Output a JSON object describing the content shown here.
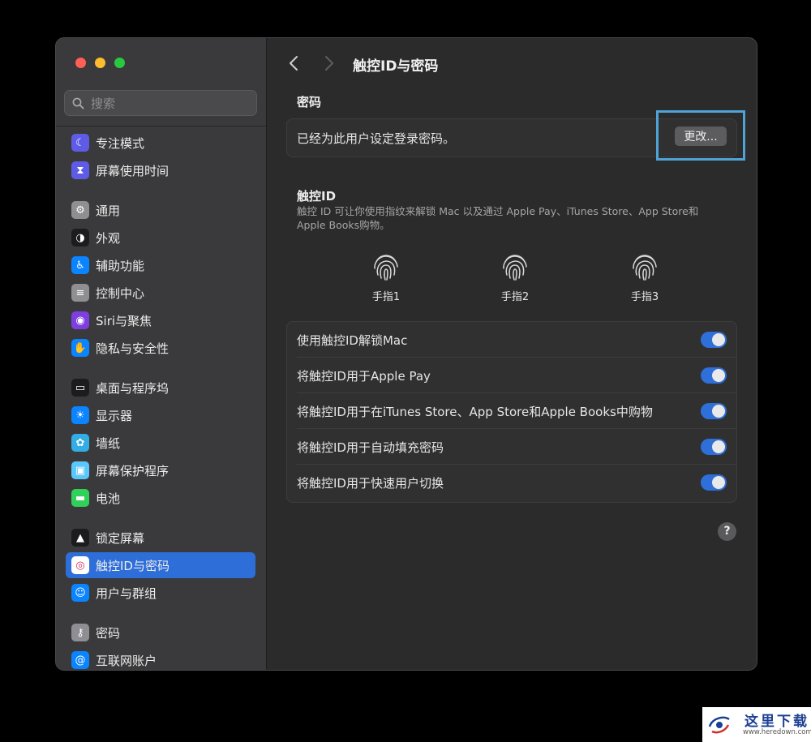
{
  "sidebar": {
    "search_placeholder": "搜索",
    "items": [
      {
        "label": "专注模式",
        "icon": "moon-icon",
        "color": "#5e5ce6"
      },
      {
        "label": "屏幕使用时间",
        "icon": "hourglass-icon",
        "color": "#5e5ce6"
      },
      {
        "label": "通用",
        "icon": "gear-icon",
        "color": "#8e8e93"
      },
      {
        "label": "外观",
        "icon": "appearance-icon",
        "color": "#1c1c1e"
      },
      {
        "label": "辅助功能",
        "icon": "accessibility-icon",
        "color": "#0a84ff"
      },
      {
        "label": "控制中心",
        "icon": "control-center-icon",
        "color": "#8e8e93"
      },
      {
        "label": "Siri与聚焦",
        "icon": "siri-icon",
        "color": "#7d3fe0"
      },
      {
        "label": "隐私与安全性",
        "icon": "hand-icon",
        "color": "#0a84ff"
      },
      {
        "label": "桌面与程序坞",
        "icon": "dock-icon",
        "color": "#1c1c1e"
      },
      {
        "label": "显示器",
        "icon": "sun-icon",
        "color": "#0a84ff"
      },
      {
        "label": "墙纸",
        "icon": "flower-icon",
        "color": "#32ade6"
      },
      {
        "label": "屏幕保护程序",
        "icon": "screensaver-icon",
        "color": "#5ac8fa"
      },
      {
        "label": "电池",
        "icon": "battery-icon",
        "color": "#30d158"
      },
      {
        "label": "锁定屏幕",
        "icon": "lock-icon",
        "color": "#1c1c1e"
      },
      {
        "label": "触控ID与密码",
        "icon": "fingerprint-icon",
        "color": "#ffffff"
      },
      {
        "label": "用户与群组",
        "icon": "users-icon",
        "color": "#0a84ff"
      },
      {
        "label": "密码",
        "icon": "key-icon",
        "color": "#8e8e93"
      },
      {
        "label": "互联网账户",
        "icon": "at-icon",
        "color": "#0a84ff"
      }
    ],
    "selected_label": "触控ID与密码"
  },
  "header": {
    "title": "触控ID与密码"
  },
  "password": {
    "section_title": "密码",
    "status_text": "已经为此用户设定登录密码。",
    "change_button": "更改..."
  },
  "touch_id": {
    "section_title": "触控ID",
    "description": "触控 ID 可让你使用指纹来解锁 Mac 以及通过 Apple Pay、iTunes Store、App Store和 Apple Books购物。",
    "fingers": [
      "手指1",
      "手指2",
      "手指3"
    ],
    "options": [
      {
        "label": "使用触控ID解锁Mac",
        "on": true
      },
      {
        "label": "将触控ID用于Apple Pay",
        "on": true
      },
      {
        "label": "将触控ID用于在iTunes Store、App Store和Apple Books中购物",
        "on": true
      },
      {
        "label": "将触控ID用于自动填充密码",
        "on": true
      },
      {
        "label": "将触控ID用于快速用户切换",
        "on": true
      }
    ]
  },
  "help_button": "?",
  "colors": {
    "accent": "#2e6ed9",
    "highlight_box": "#4fa3d6",
    "toggle_on": "#2f6fda"
  },
  "watermark": {
    "text": "这里下载",
    "url": "www.heredown.com"
  }
}
